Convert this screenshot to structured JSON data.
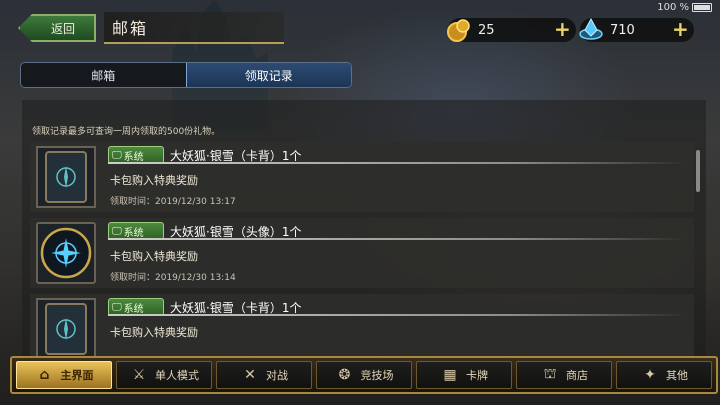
{
  "status": {
    "battery": "100 %"
  },
  "header": {
    "back_label": "返回",
    "title": "邮箱"
  },
  "currency": {
    "gold": "25",
    "gem": "710"
  },
  "tabs": [
    {
      "label": "邮箱"
    },
    {
      "label": "领取记录",
      "active": true
    }
  ],
  "note": "领取记录最多可查询一周内领取的500份礼物。",
  "records": [
    {
      "badge": "系统",
      "name": "大妖狐·银雪（卡背）1个",
      "desc": "卡包购入特典奖励",
      "time": "领取时间：2019/12/30 13:17",
      "thumb": "card-back"
    },
    {
      "badge": "系统",
      "name": "大妖狐·银雪（头像）1个",
      "desc": "卡包购入特典奖励",
      "time": "领取时间：2019/12/30 13:14",
      "thumb": "avatar"
    },
    {
      "badge": "系统",
      "name": "大妖狐·银雪（卡背）1个",
      "desc": "卡包购入特典奖励",
      "time": "",
      "thumb": "card-back"
    }
  ],
  "nav": [
    {
      "label": "主界面",
      "icon": "home-icon",
      "active": true
    },
    {
      "label": "单人模式",
      "icon": "sword-icon"
    },
    {
      "label": "对战",
      "icon": "crossed-swords-icon"
    },
    {
      "label": "竞技场",
      "icon": "arena-icon"
    },
    {
      "label": "卡牌",
      "icon": "cards-icon"
    },
    {
      "label": "商店",
      "icon": "shop-icon"
    },
    {
      "label": "其他",
      "icon": "more-icon"
    }
  ]
}
